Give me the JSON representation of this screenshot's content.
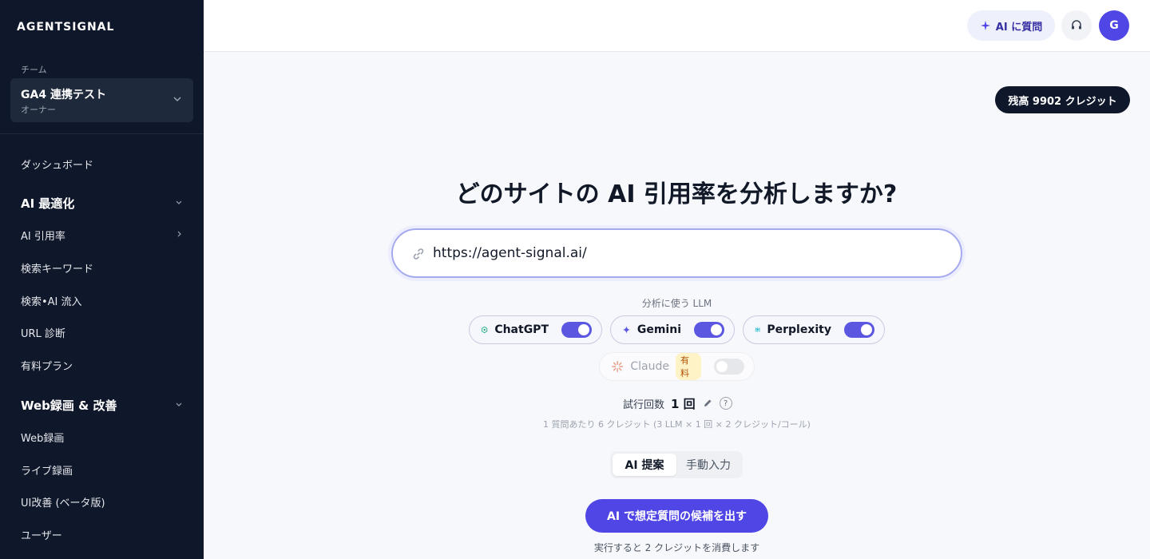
{
  "sidebar": {
    "brand": "AGENTSIGNAL",
    "team_label": "チーム",
    "team_name": "GA4 連携テスト",
    "team_role": "オーナー",
    "items": [
      {
        "label": "ダッシュボード"
      },
      {
        "label": "AI 最適化"
      },
      {
        "label": "AI 引用率"
      },
      {
        "label": "検索キーワード"
      },
      {
        "label": "検索•AI 流入"
      },
      {
        "label": "URL 診断"
      },
      {
        "label": "有料プラン"
      },
      {
        "label": "Web録画 & 改善"
      },
      {
        "label": "Web録画"
      },
      {
        "label": "ライブ録画"
      },
      {
        "label": "UI改善 (ベータ版)"
      },
      {
        "label": "ユーザー"
      }
    ]
  },
  "topbar": {
    "ask_ai_label": "AI に質問",
    "avatar_initial": "G"
  },
  "balance_label": "残高 9902 クレジット",
  "main": {
    "headline": "どのサイトの AI 引用率を分析しますか?",
    "url_value": "https://agent-signal.ai/",
    "llm_label": "分析に使う LLM",
    "llms": [
      {
        "name": "ChatGPT",
        "enabled": true
      },
      {
        "name": "Gemini",
        "enabled": true
      },
      {
        "name": "Perplexity",
        "enabled": true
      },
      {
        "name": "Claude",
        "enabled": false,
        "badge": "有料"
      }
    ],
    "trial_label": "試行回数",
    "trial_value": "1 回",
    "help_glyph": "?",
    "credit_note": "1 質問あたり 6 クレジット (3 LLM × 1 回 × 2 クレジット/コール)",
    "tabs": [
      {
        "label": "AI 提案",
        "active": true
      },
      {
        "label": "手動入力",
        "active": false
      }
    ],
    "cta_label": "AI で想定質問の候補を出す",
    "cta_note": "実行すると 2 クレジットを消費します"
  },
  "colors": {
    "sidebar_bg": "#0f172a",
    "accent": "#4f46e5",
    "toggle_on": "#5b57e0"
  }
}
